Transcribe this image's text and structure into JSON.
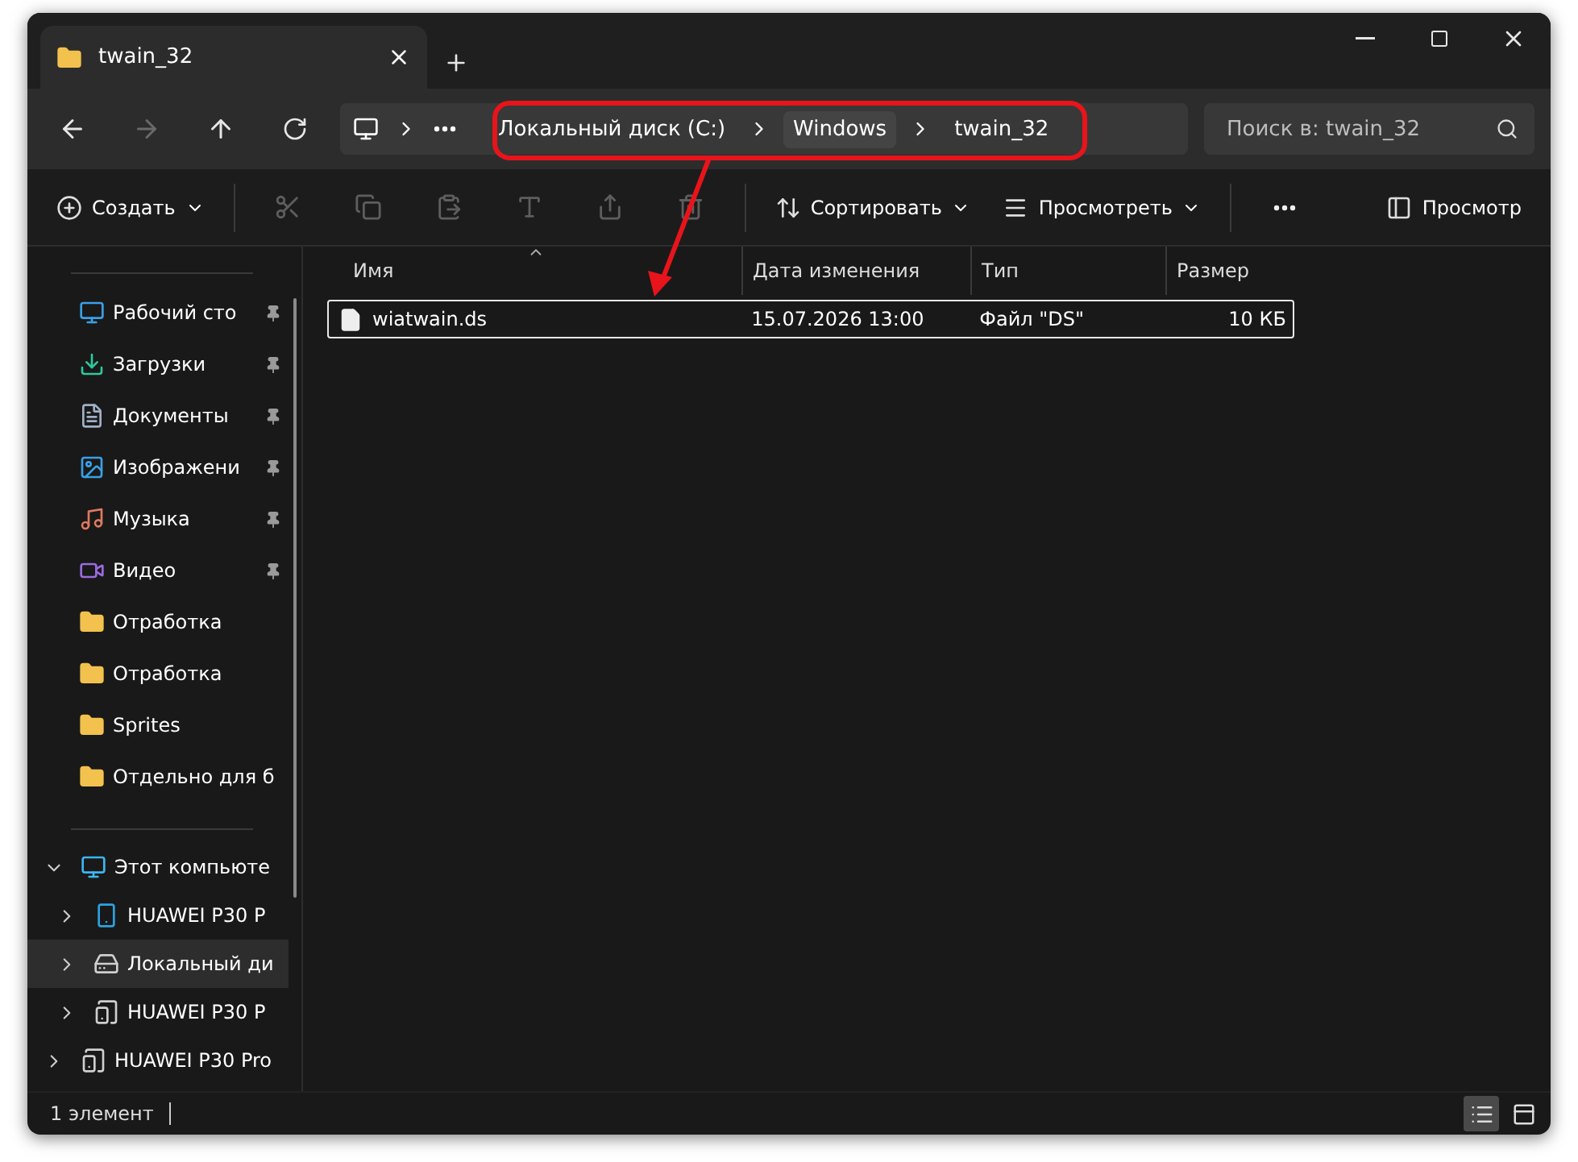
{
  "window": {
    "tab_title": "twain_32"
  },
  "address_bar": {
    "crumbs": [
      "Локальный диск (C:)",
      "Windows",
      "twain_32"
    ]
  },
  "search": {
    "placeholder": "Поиск в: twain_32"
  },
  "toolbar": {
    "items": [
      {
        "kind": "menu",
        "label": "Создать"
      },
      {
        "kind": "separator"
      },
      {
        "kind": "icon",
        "disabled": true
      },
      {
        "kind": "icon",
        "disabled": true
      },
      {
        "kind": "icon",
        "disabled": true
      },
      {
        "kind": "icon",
        "disabled": true
      },
      {
        "kind": "icon",
        "disabled": true
      },
      {
        "kind": "icon",
        "disabled": true
      },
      {
        "kind": "separator"
      },
      {
        "kind": "menu",
        "label": "Сортировать"
      },
      {
        "kind": "menu",
        "label": "Просмотреть"
      },
      {
        "kind": "separator"
      },
      {
        "kind": "icon",
        "disabled": false
      }
    ],
    "preview_label": "Просмотр"
  },
  "sidebar": {
    "quick_access": [
      {
        "label": "Рабочий сто",
        "pinned": true
      },
      {
        "label": "Загрузки",
        "pinned": true
      },
      {
        "label": "Документы",
        "pinned": true
      },
      {
        "label": "Изображени",
        "pinned": true
      },
      {
        "label": "Музыка",
        "pinned": true
      },
      {
        "label": "Видео",
        "pinned": true
      },
      {
        "label": "Отработка",
        "pinned": false
      },
      {
        "label": "Отработка",
        "pinned": false
      },
      {
        "label": "Sprites",
        "pinned": false
      },
      {
        "label": "Отдельно для б",
        "pinned": false
      }
    ],
    "tree": [
      {
        "label": "Этот компьюте",
        "expanded": true,
        "selected": false,
        "children": [
          {
            "label": "HUAWEI P30 P",
            "expanded": false,
            "selected": false
          },
          {
            "label": "Локальный ди",
            "expanded": false,
            "selected": true
          },
          {
            "label": "HUAWEI P30 P",
            "expanded": false,
            "selected": false
          }
        ]
      },
      {
        "label": "HUAWEI P30 Pro",
        "expanded": false,
        "selected": false
      }
    ]
  },
  "table": {
    "columns": [
      "Имя",
      "Дата изменения",
      "Тип",
      "Размер"
    ],
    "rows": [
      {
        "name": "wiatwain.ds",
        "date": "15.07.2026 13:00",
        "type": "Файл \"DS\"",
        "size": "10 КБ",
        "selected": true
      }
    ]
  },
  "status_bar": {
    "count": "1 элемент",
    "views": [
      {
        "kind": "details",
        "selected": true
      },
      {
        "kind": "tiles",
        "selected": false
      }
    ]
  }
}
